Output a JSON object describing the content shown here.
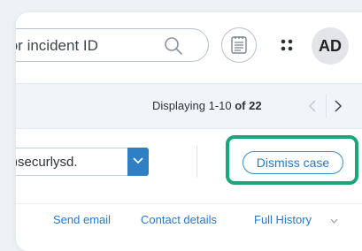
{
  "header": {
    "search": {
      "placeholder": "ail or incident ID",
      "icon": "search-icon"
    },
    "notes_icon": "notepad-icon",
    "apps_icon": "apps-grid-icon",
    "avatar_initials": "AD"
  },
  "pagination": {
    "prefix": "Displaying 1-10",
    "of_label": "of",
    "total": "22",
    "prev_icon": "chevron-left-icon",
    "next_icon": "chevron-right-icon"
  },
  "actions": {
    "assignee_value": ")securlysd.",
    "dropdown_icon": "chevron-down-icon",
    "dismiss_label": "Dismiss case"
  },
  "links": {
    "send_email": "Send email",
    "contact_details": "Contact details",
    "full_history": "Full History"
  },
  "colors": {
    "accent_blue": "#2e7fc4",
    "link_blue": "#2979c2",
    "highlight_green": "#1aa57a"
  }
}
